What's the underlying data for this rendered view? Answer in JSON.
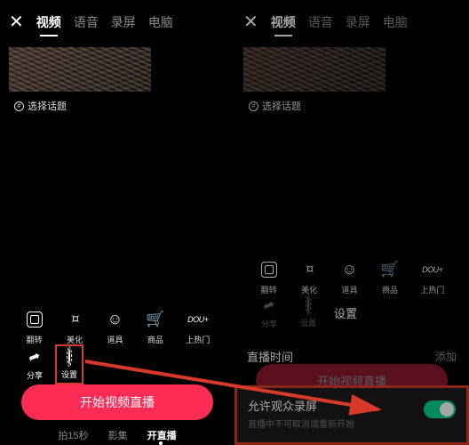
{
  "tabs": {
    "close": "✕",
    "video": "视频",
    "voice": "语音",
    "record": "录屏",
    "pc": "电脑"
  },
  "topic": "选择话题",
  "tools": {
    "flip": "翻转",
    "beauty": "美化",
    "props": "道具",
    "goods": "商品",
    "hot": "上热门",
    "dou": "DOU+"
  },
  "row2": {
    "share": "分享",
    "settings": "设置"
  },
  "start": "开始视频直播",
  "bottom": {
    "shoot": "拍15秒",
    "album": "影集",
    "live": "开直播"
  },
  "right": {
    "settings_label": "设置",
    "time_label": "直播时间",
    "add": "添加",
    "panel_title": "允许观众录屏",
    "panel_sub": "直播中不可取消或重新开始"
  }
}
